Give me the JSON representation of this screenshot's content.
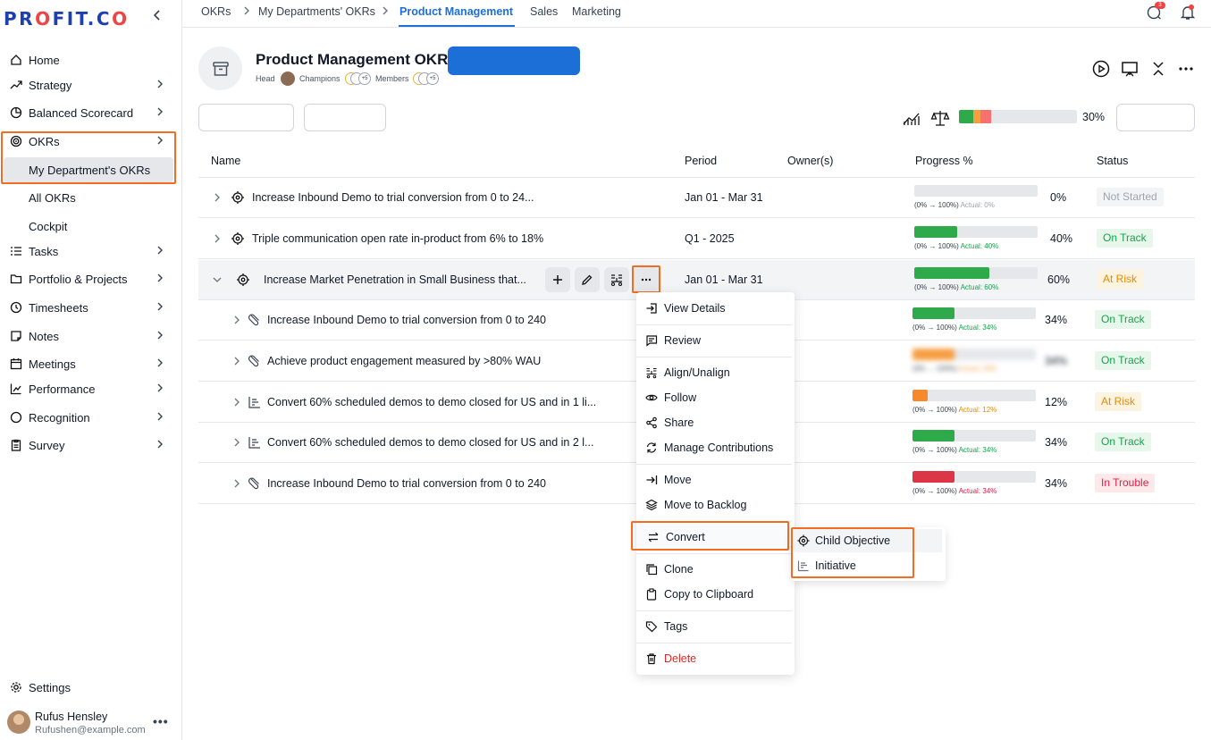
{
  "brand": {
    "logo": "PROFIT.CO"
  },
  "sidebar": {
    "items": [
      {
        "label": "Home",
        "icon": "home-icon"
      },
      {
        "label": "Strategy",
        "icon": "trend-icon"
      },
      {
        "label": "Balanced Scorecard",
        "icon": "pie-icon"
      },
      {
        "label": "OKRs",
        "icon": "target-icon"
      },
      {
        "label": "My Department's OKRs"
      },
      {
        "label": "All OKRs"
      },
      {
        "label": "Cockpit"
      },
      {
        "label": "Tasks",
        "icon": "list-icon"
      },
      {
        "label": "Portfolio & Projects",
        "icon": "folder-icon"
      },
      {
        "label": "Timesheets",
        "icon": "clock-icon"
      },
      {
        "label": "Notes",
        "icon": "note-icon"
      },
      {
        "label": "Meetings",
        "icon": "calendar-icon"
      },
      {
        "label": "Performance",
        "icon": "chart-icon"
      },
      {
        "label": "Recognition",
        "icon": "circle-icon"
      },
      {
        "label": "Survey",
        "icon": "clipboard-icon"
      }
    ],
    "settings": "Settings",
    "user": {
      "name": "Rufus Hensley",
      "email": "Rufushen@example.com"
    }
  },
  "topnav": {
    "crumbs": [
      "OKRs",
      "My Departments' OKRs"
    ],
    "tabs": [
      "Product Management",
      "Sales",
      "Marketing"
    ],
    "notification_count": "3"
  },
  "header": {
    "title": "Product Management OKRs",
    "head_label": "Head",
    "champions_label": "Champions",
    "members_label": "Members",
    "extra_count": "+5",
    "overall_progress": "30%",
    "overall_segments": [
      {
        "color": "#2eaa4a",
        "fraction": 0.12
      },
      {
        "color": "#f59e42",
        "fraction": 0.06
      },
      {
        "color": "#f87171",
        "fraction": 0.09
      }
    ]
  },
  "table": {
    "columns": [
      "Name",
      "Period",
      "Owner(s)",
      "Progress %",
      "Status"
    ],
    "rows": [
      {
        "name": "Increase Inbound Demo to trial conversion from 0 to 24...",
        "period": "Jan 01 - Mar 31",
        "progress": 0,
        "pct": "0%",
        "cap_a": "(0% → 100%)",
        "cap_b": "Actual: 0%",
        "status": "Not Started",
        "bar_color": "#2eaa4a",
        "cap_color": "#9ca3af"
      },
      {
        "name": "Triple communication open rate in-product from 6% to 18%",
        "period": "Q1 - 2025",
        "progress": 0.4,
        "pct": "40%",
        "cap_a": "(0% → 100%)",
        "cap_b": "Actual: 40%",
        "status": "On Track",
        "bar_color": "#2eaa4a",
        "cap_color": "#16a34a"
      },
      {
        "name": "Increase Market Penetration in Small Business that...",
        "period": "Jan 01 - Mar 31",
        "progress": 0.6,
        "pct": "60%",
        "cap_a": "(0% → 100%)",
        "cap_b": "Actual: 60%",
        "status": "At Risk",
        "bar_color": "#2eaa4a",
        "cap_color": "#16a34a"
      },
      {
        "name": "Increase Inbound Demo to trial conversion from 0 to 240",
        "progress": 0.34,
        "pct": "34%",
        "cap_a": "(0% → 100%)",
        "cap_b": "Actual: 34%",
        "status": "On Track",
        "bar_color": "#2eaa4a",
        "cap_color": "#16a34a"
      },
      {
        "name": "Achieve product engagement measured by >80% WAU",
        "progress": 0.34,
        "pct": "34%",
        "cap_a": "(0% → 100%)",
        "cap_b": "Actual: 34%",
        "status": "On Track",
        "bar_color": "#f59e42",
        "cap_color": "#f59e42"
      },
      {
        "name": "Convert 60% scheduled demos to demo closed for US  and in 1 li...",
        "progress": 0.12,
        "pct": "12%",
        "cap_a": "(0% → 100%)",
        "cap_b": "Actual: 12%",
        "status": "At Risk",
        "bar_color": "#f5892b",
        "cap_color": "#e38b06"
      },
      {
        "name": "Convert 60% scheduled demos to demo closed for US  and in 2 l...",
        "progress": 0.34,
        "pct": "34%",
        "cap_a": "(0% → 100%)",
        "cap_b": "Actual: 34%",
        "status": "On Track",
        "bar_color": "#2eaa4a",
        "cap_color": "#16a34a"
      },
      {
        "name": "Increase Inbound Demo to trial conversion from 0 to 240",
        "progress": 0.34,
        "pct": "34%",
        "cap_a": "(0% → 100%)",
        "cap_b": "Actual: 34%",
        "status": "In Trouble",
        "bar_color": "#dc3545",
        "cap_color": "#e11d48"
      }
    ]
  },
  "menu": {
    "items": [
      "View Details",
      "Review",
      "Align/Unalign",
      "Follow",
      "Share",
      "Manage Contributions",
      "Move",
      "Move to Backlog",
      "Convert",
      "Clone",
      "Copy to Clipboard",
      "Tags",
      "Delete"
    ],
    "submenu": [
      "Child Objective",
      "Initiative"
    ]
  }
}
